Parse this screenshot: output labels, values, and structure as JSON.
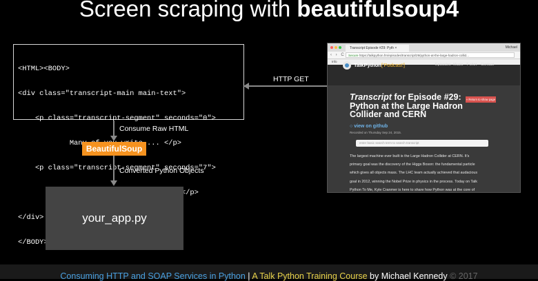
{
  "title": {
    "light": "Screen scraping with ",
    "bold": "beautifulsoup4"
  },
  "code": {
    "lines": [
      "<HTML><BODY>",
      "<div class=\"transcript-main main-text\">",
      "    <p class=\"transcript-segment\" seconds=\"0\">",
      "            Many of you write ... </p>",
      "    <p class=\"transcript-segment\" seconds=\"7\">",
      "            This week you'll meet ... </p>",
      "</div>",
      "</BODY></HTML>"
    ]
  },
  "flow": {
    "consume_label": "Consume Raw HTML",
    "bs_label": "BeautifulSoup",
    "converted_label": "Converted Python Objects",
    "app_label": "your_app.py",
    "http_label": "HTTP GET"
  },
  "browser": {
    "tab_title": "Transcript Episode #29: Pyth ×",
    "user": "Michael",
    "nav_icons": "‹ › C ⌂",
    "url_secure": "Secure",
    "url_rest": "https://talkpython.fm/episodes/transcript/29/python-at-the-large-hadron-collid...",
    "bookmarks": "Info",
    "brand": "TalkPython",
    "brand_podcast": "['Podcast']",
    "menu": [
      "Episodes",
      "Music",
      "T-shirt",
      "Contact"
    ],
    "heading_italic": "Transcript",
    "heading_rest1": " for Episode #29:",
    "heading_line2": "Python at the Large Hadron",
    "heading_line3": "Collider and CERN",
    "return_button": "« Return to show page",
    "github_link": "view on github",
    "recorded": "Recorded on Thursday Sep 24, 2015.",
    "search_placeholder": "enter basic search term to search transcript",
    "paragraph": [
      "The largest machine ever built is the Large Hadron Collider at CERN. It's",
      "primary goal was the discovery of the Higgs Boson: the fundamental particle",
      "which gives all objects mass. The LHC team actually achieved that audacious",
      "goal in 2012, winning the Nobel Prize in physics in the process. Today on Talk",
      "Python To Me, Kyle Cranmer is here to share how Python was at the core of"
    ]
  },
  "footer": {
    "part1": "Consuming HTTP and SOAP Services in Python",
    "sep": " | ",
    "part2": "A Talk Python Training Course",
    "part3": " by Michael Kennedy",
    "part4": " © 2017"
  },
  "colors": {
    "accent_orange": "#f5921f",
    "footer_blue": "#4aa0e0",
    "footer_yellow": "#e8d24a"
  }
}
